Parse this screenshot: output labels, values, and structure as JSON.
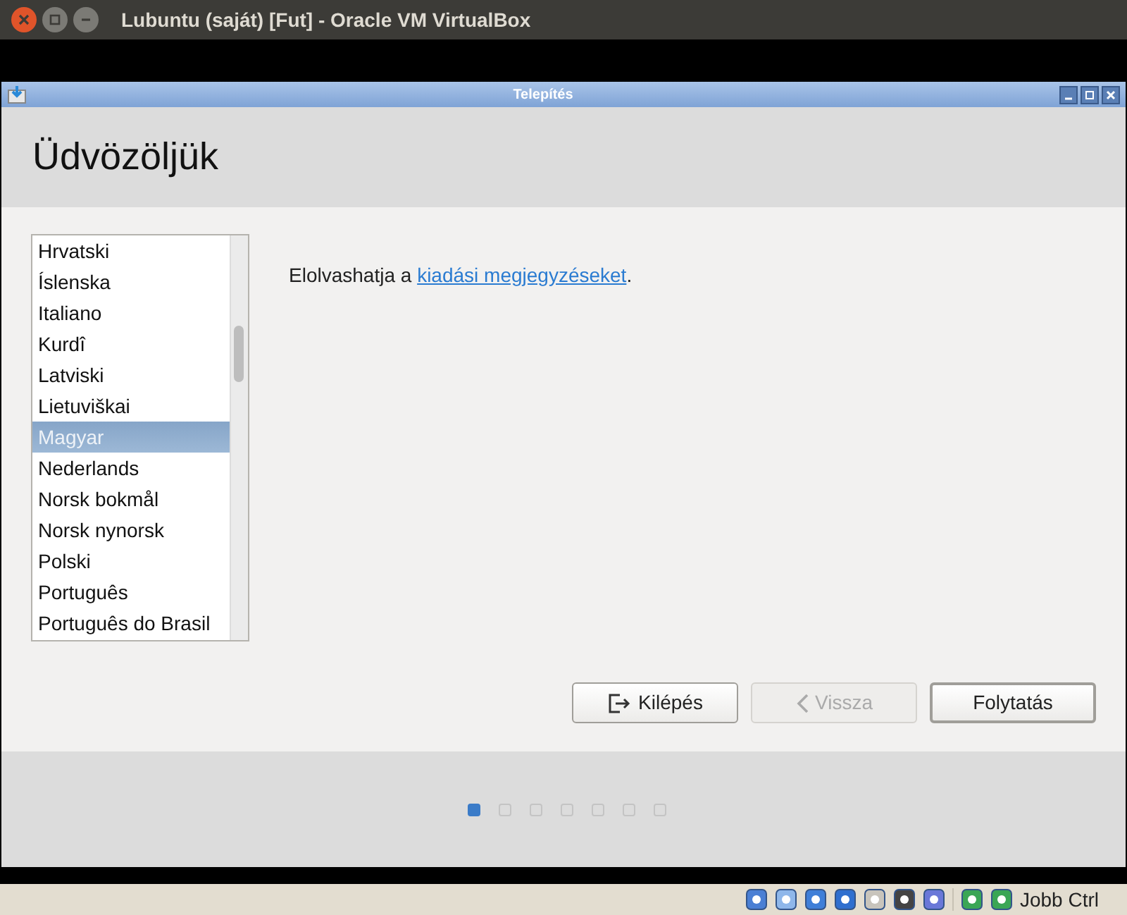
{
  "window": {
    "title": "Lubuntu (saját) [Fut] - Oracle VM VirtualBox"
  },
  "installer": {
    "title": "Telepítés",
    "heading": "Üdvözöljük",
    "languages": [
      {
        "label": "Hrvatski",
        "selected": false
      },
      {
        "label": "Íslenska",
        "selected": false
      },
      {
        "label": "Italiano",
        "selected": false
      },
      {
        "label": "Kurdî",
        "selected": false
      },
      {
        "label": "Latviski",
        "selected": false
      },
      {
        "label": "Lietuviškai",
        "selected": false
      },
      {
        "label": "Magyar",
        "selected": true
      },
      {
        "label": "Nederlands",
        "selected": false
      },
      {
        "label": "Norsk bokmål",
        "selected": false
      },
      {
        "label": "Norsk nynorsk",
        "selected": false
      },
      {
        "label": "Polski",
        "selected": false
      },
      {
        "label": "Português",
        "selected": false
      },
      {
        "label": "Português do Brasil",
        "selected": false
      }
    ],
    "notes_text": "Elolvashatja a ",
    "notes_link": "kiadási megjegyzéseket",
    "notes_end": ".",
    "buttons": [
      {
        "label": "Kilépés",
        "kind": "quit",
        "disabled": false
      },
      {
        "label": "Vissza",
        "kind": "back",
        "disabled": true
      },
      {
        "label": "Folytatás",
        "kind": "default",
        "disabled": false
      }
    ],
    "steps": [
      {
        "selected": true
      },
      {
        "selected": false
      },
      {
        "selected": false
      },
      {
        "selected": false
      },
      {
        "selected": false
      },
      {
        "selected": false
      },
      {
        "selected": false
      }
    ]
  },
  "status_bar": {
    "host_key": "Jobb Ctrl"
  }
}
